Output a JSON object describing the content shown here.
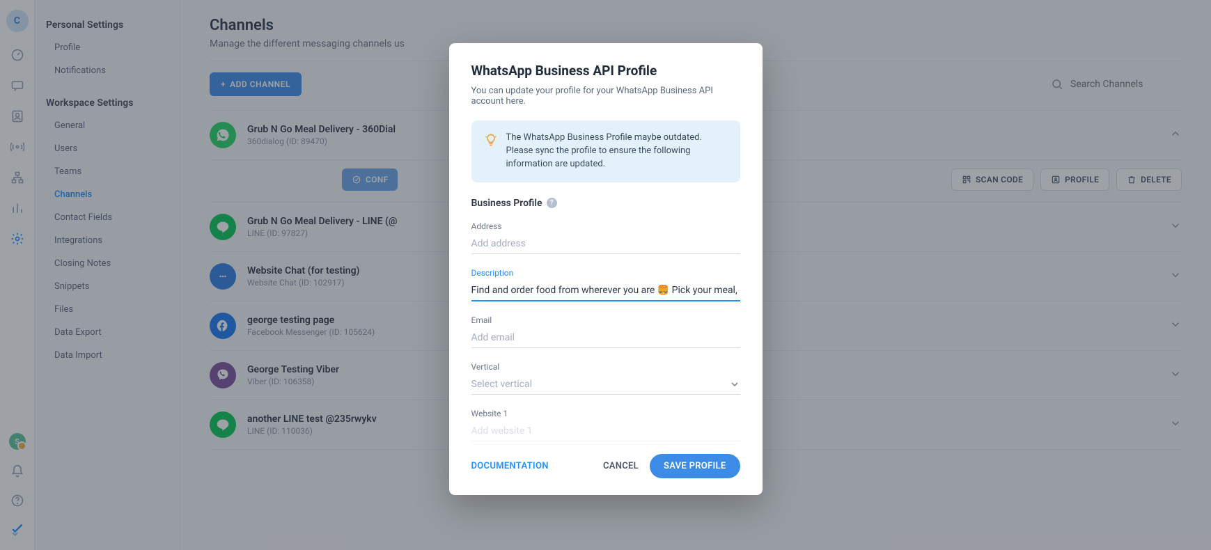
{
  "rail": {
    "avatar_letter": "C",
    "user_letter": "S"
  },
  "sidebar": {
    "personal_heading": "Personal Settings",
    "personal_items": [
      "Profile",
      "Notifications"
    ],
    "workspace_heading": "Workspace Settings",
    "workspace_items": [
      "General",
      "Users",
      "Teams",
      "Channels",
      "Contact Fields",
      "Integrations",
      "Closing Notes",
      "Snippets",
      "Files",
      "Data Export",
      "Data Import"
    ]
  },
  "page": {
    "title": "Channels",
    "subtitle": "Manage the different messaging channels us",
    "add_channel": "ADD CHANNEL",
    "search_placeholder": "Search Channels"
  },
  "channels": [
    {
      "name": "Grub N Go Meal Delivery - 360Dial",
      "sub": "360dialog (ID: 89470)",
      "type": "wa",
      "expanded": true
    },
    {
      "name": "Grub N Go Meal Delivery - LINE (@",
      "sub": "LINE (ID: 97827)",
      "type": "line",
      "expanded": false
    },
    {
      "name": "Website Chat (for testing)",
      "sub": "Website Chat (ID: 102917)",
      "type": "chat",
      "expanded": false
    },
    {
      "name": "george testing page",
      "sub": "Facebook Messenger (ID: 105624)",
      "type": "fb",
      "expanded": false
    },
    {
      "name": "George Testing Viber",
      "sub": "Viber (ID: 106358)",
      "type": "viber",
      "expanded": false
    },
    {
      "name": "another LINE test @235rwykv",
      "sub": "LINE (ID: 110036)",
      "type": "line",
      "expanded": false
    }
  ],
  "actions": {
    "configuration": "CONF",
    "scan_code": "SCAN CODE",
    "profile": "PROFILE",
    "delete": "DELETE"
  },
  "modal": {
    "title": "WhatsApp Business API Profile",
    "subtitle": "You can update your profile for your WhatsApp Business API account here.",
    "info": "The WhatsApp Business Profile maybe outdated. Please sync the profile to ensure the following information are updated.",
    "section": "Business Profile",
    "fields": {
      "address_label": "Address",
      "address_placeholder": "Add address",
      "description_label": "Description",
      "description_value": "Find and order food from wherever you are 🍔 Pick your meal, confirm your o",
      "email_label": "Email",
      "email_placeholder": "Add email",
      "vertical_label": "Vertical",
      "vertical_placeholder": "Select vertical",
      "website1_label": "Website 1",
      "website1_placeholder": "Add website 1"
    },
    "documentation": "DOCUMENTATION",
    "cancel": "CANCEL",
    "save": "SAVE PROFILE"
  }
}
